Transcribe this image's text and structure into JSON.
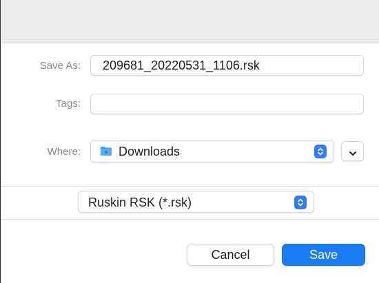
{
  "dialog": {
    "save_as_label": "Save As:",
    "save_as_value": "209681_20220531_1106.rsk",
    "tags_label": "Tags:",
    "tags_value": "",
    "where_label": "Where:",
    "where_value": "Downloads",
    "where_icon": "folder-icon",
    "format_value": "Ruskin RSK (*.rsk)",
    "cancel_label": "Cancel",
    "save_label": "Save"
  },
  "colors": {
    "accent": "#1a7cf3",
    "folder": "#3d9ef0",
    "label_gray": "#8a8a8a"
  }
}
